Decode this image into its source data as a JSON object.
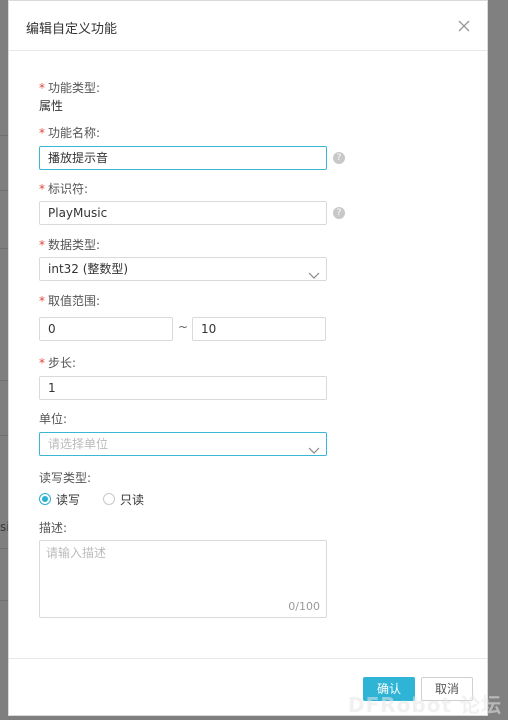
{
  "dialog": {
    "title": "编辑自定义功能",
    "close_icon": "close-icon"
  },
  "form": {
    "feature_type": {
      "label": "功能类型:",
      "value": "属性"
    },
    "feature_name": {
      "label": "功能名称:",
      "value": "播放提示音"
    },
    "identifier": {
      "label": "标识符:",
      "value": "PlayMusic"
    },
    "data_type": {
      "label": "数据类型:",
      "value": "int32 (整数型)"
    },
    "value_range": {
      "label": "取值范围:",
      "min": "0",
      "separator": "~",
      "max": "10"
    },
    "step": {
      "label": "步长:",
      "value": "1"
    },
    "unit": {
      "label": "单位:",
      "placeholder": "请选择单位"
    },
    "rw_type": {
      "label": "读写类型:",
      "options": [
        {
          "label": "读写",
          "checked": true
        },
        {
          "label": "只读",
          "checked": false
        }
      ]
    },
    "description": {
      "label": "描述:",
      "placeholder": "请输入描述",
      "counter": "0/100"
    },
    "required_mark": "*",
    "help_mark": "?"
  },
  "footer": {
    "confirm_label": "确认",
    "cancel_label": "取消"
  },
  "background": {
    "side_text": "si"
  },
  "watermark": "DFRobot 论坛",
  "colors": {
    "accent": "#2fb4d6",
    "required": "#e0463d",
    "focus_border": "#3cb6d6"
  }
}
